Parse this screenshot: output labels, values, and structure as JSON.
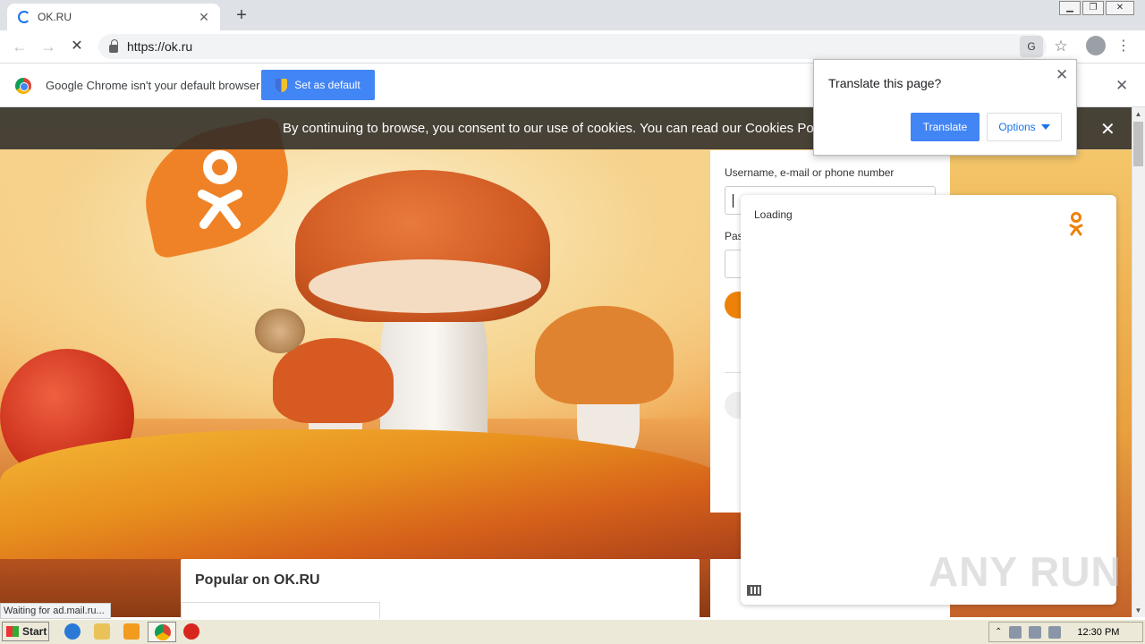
{
  "browser": {
    "tab_title": "OK.RU",
    "url": "https://ok.ru",
    "window_controls": [
      "minimize",
      "restore",
      "close"
    ]
  },
  "infobar": {
    "message": "Google Chrome isn't your default browser",
    "set_default_label": "Set as default"
  },
  "translate_popup": {
    "title": "Translate this page?",
    "translate_label": "Translate",
    "options_label": "Options"
  },
  "page": {
    "cookie_text": "By continuing to browse, you consent to our use of cookies. You can read our Cookies Policy",
    "login": {
      "username_label": "Username, e-mail or phone number",
      "password_label": "Pas"
    },
    "loading_text": "Loading",
    "popular_title": "Popular on OK.RU"
  },
  "status_bar": {
    "text": "Waiting for ad.mail.ru..."
  },
  "taskbar": {
    "start_label": "Start",
    "clock": "12:30 PM"
  },
  "watermark": "ANY RUN",
  "colors": {
    "ok_orange": "#ee8208",
    "chrome_blue": "#4285f4"
  }
}
